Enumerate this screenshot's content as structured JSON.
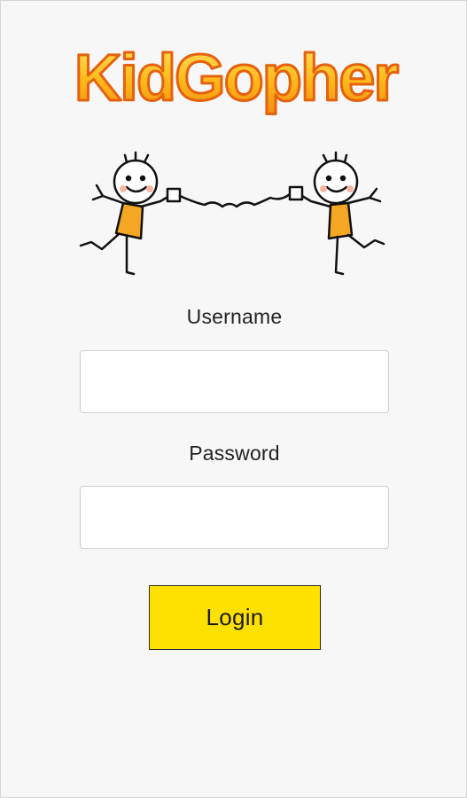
{
  "app": {
    "logo_text": "KidGopher",
    "logo_icon": "kidgopher-logo",
    "illustration_icon": "kids-tin-can-phone-illustration"
  },
  "form": {
    "username_label": "Username",
    "username_value": "",
    "password_label": "Password",
    "password_value": "",
    "login_label": "Login"
  },
  "colors": {
    "background": "#f7f7f7",
    "button": "#ffe100",
    "logo_fill": "#fdb913",
    "logo_stroke": "#e85a0c"
  }
}
